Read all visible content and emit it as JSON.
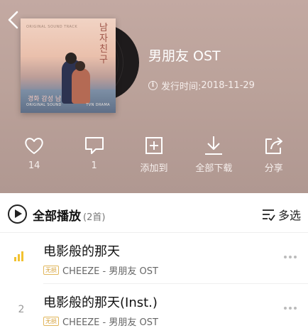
{
  "album": {
    "title": "男朋友 OST",
    "release_label": "发行时间:",
    "release_date": "2018-11-29",
    "info_icon_glyph": "i",
    "cover": {
      "top_caption": "ORIGINAL SOUND TRACK",
      "hangul_title": "남자친구",
      "stamp_text": "경화 감성 남",
      "foot_left": "ORIGINAL SOUND",
      "foot_right": "TVN DRAMA"
    }
  },
  "actions": [
    {
      "name": "like",
      "icon": "heart-icon",
      "label": "14"
    },
    {
      "name": "comment",
      "icon": "comment-icon",
      "label": "1"
    },
    {
      "name": "add-to",
      "icon": "add-box-icon",
      "label": "添加到"
    },
    {
      "name": "download-all",
      "icon": "download-icon",
      "label": "全部下载"
    },
    {
      "name": "share",
      "icon": "share-icon",
      "label": "分享"
    }
  ],
  "playlist": {
    "play_all_label": "全部播放",
    "count": "(2首)",
    "multi_select_label": "多选"
  },
  "songs": [
    {
      "index": "",
      "playing": true,
      "title": "电影般的那天",
      "badge": "无损",
      "artist_album": "CHEEZE - 男朋友 OST"
    },
    {
      "index": "2",
      "playing": false,
      "title": "电影般的那天(Inst.)",
      "badge": "无损",
      "artist_album": "CHEEZE - 男朋友 OST"
    }
  ],
  "colors": {
    "header_bg": "#b9a09a",
    "playing_indicator": "#f2c230",
    "badge": "#d6a23c"
  }
}
